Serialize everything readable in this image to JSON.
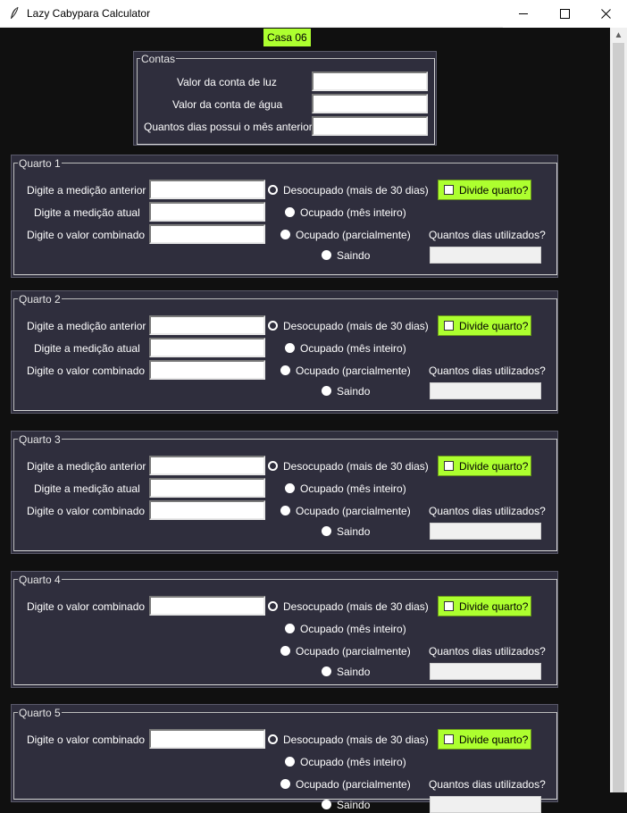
{
  "window": {
    "title": "Lazy Cabypara Calculator",
    "min": "—",
    "max": "☐",
    "close": "✕"
  },
  "casa_label": "Casa 06",
  "contas": {
    "title": "Contas",
    "luz_label": "Valor da conta de luz",
    "agua_label": "Valor da conta de água",
    "dias_label": "Quantos dias possui o mês anterior",
    "luz_value": "",
    "agua_value": "",
    "dias_value": ""
  },
  "common": {
    "med_ant": "Digite a medição anterior",
    "med_atual": "Digite a medição atual",
    "valor_comb": "Digite o valor combinado",
    "opt_desocupado": "Desocupado (mais de 30 dias)",
    "opt_inteiro": "Ocupado (mês inteiro)",
    "opt_parcial": "Ocupado (parcialmente)",
    "opt_saindo": "Saindo",
    "dias_utilizados": "Quantos dias utilizados?",
    "divide": "Divide quarto?",
    "selected_option": "Desocupado (mais de 30 dias)"
  },
  "quartos": [
    {
      "title": "Quarto 1"
    },
    {
      "title": "Quarto 2"
    },
    {
      "title": "Quarto 3"
    },
    {
      "title": "Quarto 4"
    },
    {
      "title": "Quarto 5"
    }
  ],
  "colors": {
    "accent": "#adff2f",
    "panel": "#2f2e3d",
    "background": "#101010"
  }
}
